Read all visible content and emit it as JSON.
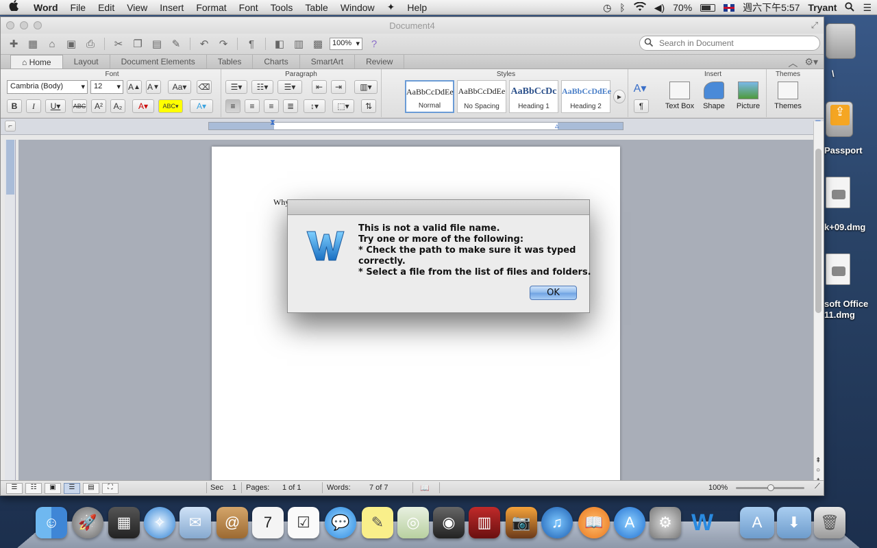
{
  "menubar": {
    "apple": "",
    "app_name": "Word",
    "menus": [
      "File",
      "Edit",
      "View",
      "Insert",
      "Format",
      "Font",
      "Tools",
      "Table",
      "Window",
      "Help"
    ],
    "battery": "70%",
    "clock": "週六下午5:57",
    "user": "Tryant"
  },
  "desktop": {
    "items": [
      "\\",
      "Passport",
      "k+09.dmg",
      "soft Office",
      "11.dmg"
    ]
  },
  "window": {
    "title": "Document4",
    "zoom": "100%",
    "search_placeholder": "Search in Document"
  },
  "ribbon": {
    "tabs": [
      "Home",
      "Layout",
      "Document Elements",
      "Tables",
      "Charts",
      "SmartArt",
      "Review"
    ],
    "active_tab": "Home",
    "groups": {
      "font": "Font",
      "paragraph": "Paragraph",
      "styles": "Styles",
      "insert": "Insert",
      "themes": "Themes"
    },
    "font_name": "Cambria (Body)",
    "font_size": "12",
    "styles": [
      {
        "sample": "AaBbCcDdEe",
        "name": "Normal"
      },
      {
        "sample": "AaBbCcDdEe",
        "name": "No Spacing"
      },
      {
        "sample": "AaBbCcDc",
        "name": "Heading 1"
      },
      {
        "sample": "AaBbCcDdEe",
        "name": "Heading 2"
      }
    ],
    "insert_buttons": [
      "Text Box",
      "Shape",
      "Picture"
    ],
    "themes_button": "Themes"
  },
  "document": {
    "visible_text": "Why"
  },
  "statusbar": {
    "sec_label": "Sec",
    "sec_value": "1",
    "pages_label": "Pages:",
    "pages_value": "1 of 1",
    "words_label": "Words:",
    "words_value": "7 of 7",
    "zoom": "100%"
  },
  "dialog": {
    "lines": [
      "This is not a valid file name.",
      "Try one or more of the following:",
      "* Check the path to make sure it was typed",
      "correctly.",
      "* Select a file from the list of files and folders."
    ],
    "ok_label": "OK"
  },
  "dock": {
    "icons": [
      "finder-icon",
      "launchpad-icon",
      "photo-booth-icon",
      "safari-icon",
      "mail-icon",
      "address-book-icon",
      "ical-icon",
      "reminders-icon",
      "messages-icon",
      "notes-icon",
      "preview-icon",
      "facetime-icon",
      "photo-booth-icon",
      "iphoto-icon",
      "itunes-icon",
      "ibooks-icon",
      "app-store-icon",
      "system-preferences-icon",
      "word-icon",
      "applications-folder-icon",
      "downloads-folder-icon",
      "trash-icon"
    ]
  }
}
